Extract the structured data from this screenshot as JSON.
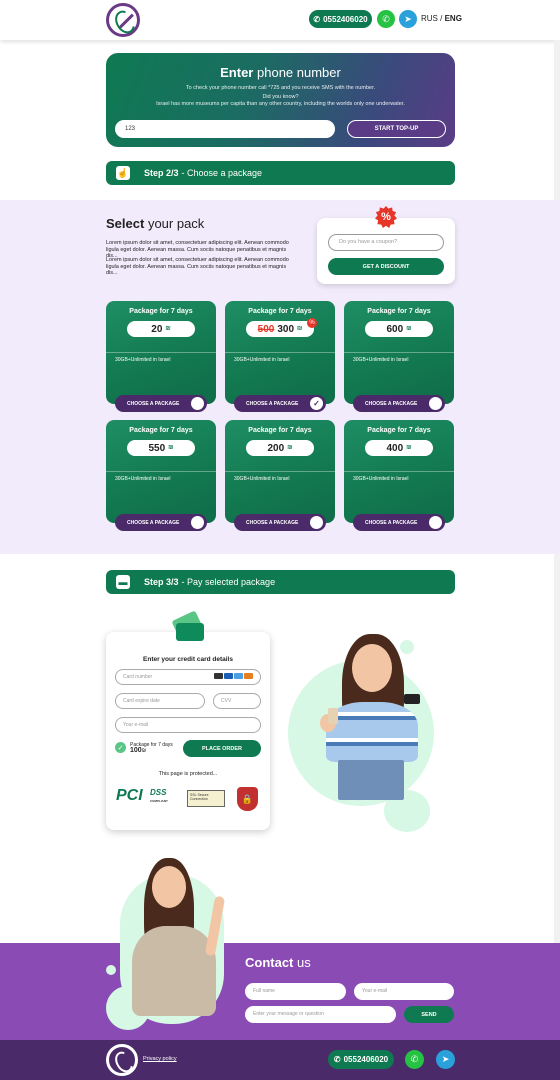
{
  "header": {
    "phone": "0552406020",
    "lang_rus": "RUS",
    "lang_sep": "/",
    "lang_eng": "ENG"
  },
  "hero": {
    "title_bold": "Enter",
    "title_rest": "phone number",
    "line1": "To check your phone number call *725 and you receive SMS with the number.",
    "line2": "Did you know?",
    "line3": "Israel has more museums per capita than any other country, including the worlds only one underwater.",
    "input_value": "123",
    "button": "START TOP-UP"
  },
  "step2": {
    "bold": "Step 2/3",
    "rest": "- Choose a package"
  },
  "packs": {
    "title_bold": "Select",
    "title_rest": "your pack",
    "lorem1": "Lorem ipsum dolor sit amet, consectetuer adipiscing elit. Aenean commodo ligula eget dolor. Aenean massa. Cum sociis natoque penatibus et magnis dis...",
    "lorem2": "Lorem ipsum dolor sit amet, consectetuer adipiscing elit. Aenean commodo ligula eget dolor. Aenean massa. Cum sociis natoque penatibus et magnis dis...",
    "coupon_placeholder": "Do you have a coupon?",
    "coupon_button": "GET A DISCOUNT",
    "currency": "₪",
    "items": [
      {
        "title": "Package for 7 days",
        "price": "20",
        "old": "",
        "desc": "30GB+Unlimited in Israel",
        "button": "CHOOSE A PACKAGE",
        "selected": false
      },
      {
        "title": "Package for 7 days",
        "price": "300",
        "old": "500",
        "desc": "30GB+Unlimited in Israel",
        "button": "CHOOSE A PACKAGE",
        "selected": true
      },
      {
        "title": "Package for 7 days",
        "price": "600",
        "old": "",
        "desc": "30GB+Unlimited in Israel",
        "button": "CHOOSE A PACKAGE",
        "selected": false
      },
      {
        "title": "Package for 7 days",
        "price": "550",
        "old": "",
        "desc": "30GB+Unlimited in Israel",
        "button": "CHOOSE A PACKAGE",
        "selected": false
      },
      {
        "title": "Package for 7 days",
        "price": "200",
        "old": "",
        "desc": "30GB+Unlimited in Israel",
        "button": "CHOOSE A PACKAGE",
        "selected": false
      },
      {
        "title": "Package for 7 days",
        "price": "400",
        "old": "",
        "desc": "30GB+Unlimited in Israel",
        "button": "CHOOSE A PACKAGE",
        "selected": false
      }
    ]
  },
  "step3": {
    "bold": "Step 3/3",
    "rest": "- Pay selected package"
  },
  "payment": {
    "title": "Enter your credit card details",
    "card_number": "Card number",
    "expire": "Card expire date",
    "cvv": "CVV",
    "email": "Your e-mail",
    "pack_label": "Package for 7 days",
    "pack_price": "100",
    "place_order": "PLACE ORDER",
    "protected": "This page is protected...",
    "pci_label": "PCI",
    "dss_label": "DSS",
    "dss_sub": "COMPLIANT",
    "ssl_label": "SSL Secure Connection"
  },
  "contact": {
    "title_bold": "Contact",
    "title_rest": "us",
    "full_name": "Full name",
    "email": "Your e-mail",
    "message": "Enter your message or question",
    "send": "SEND"
  },
  "footer": {
    "privacy": "Privacy policy",
    "phone": "0552406020"
  },
  "colors": {
    "primary_green": "#0f7a52",
    "purple": "#8a4bb4",
    "dark_purple": "#4a2a68",
    "lavender_bg": "#f1ebfb",
    "sale_red": "#e6362a"
  },
  "icons": [
    "logo-icon",
    "phone-icon",
    "whatsapp-icon",
    "telegram-icon",
    "percent-icon",
    "check-icon",
    "card-icon",
    "shield-icon"
  ]
}
